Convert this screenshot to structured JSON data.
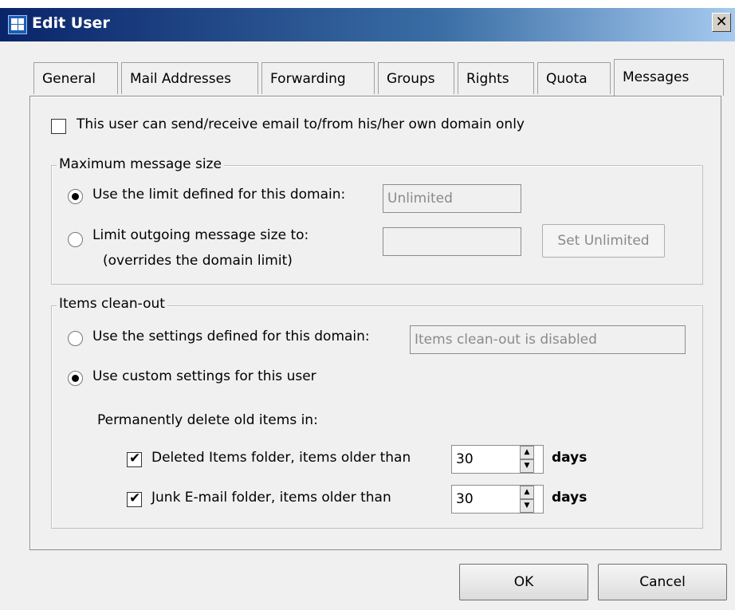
{
  "window": {
    "title": "Edit User",
    "close_glyph": "✕"
  },
  "tabs": [
    {
      "label": "General"
    },
    {
      "label": "Mail Addresses"
    },
    {
      "label": "Forwarding"
    },
    {
      "label": "Groups"
    },
    {
      "label": "Rights"
    },
    {
      "label": "Quota"
    },
    {
      "label": "Messages",
      "active": true
    }
  ],
  "own_domain_only": {
    "label": "This user can send/receive email to/from his/her own domain only",
    "checked": false
  },
  "max_size": {
    "legend": "Maximum message size",
    "use_domain_limit": {
      "label": "Use the limit defined for this domain:",
      "selected": true,
      "value": "Unlimited"
    },
    "limit_outgoing": {
      "label": "Limit outgoing message size to:",
      "note": "(overrides the domain limit)",
      "selected": false,
      "value": ""
    },
    "set_unlimited_label": "Set Unlimited"
  },
  "cleanout": {
    "legend": "Items clean-out",
    "use_domain_settings": {
      "label": "Use the settings defined for this domain:",
      "selected": false,
      "value": "Items clean-out is disabled"
    },
    "use_custom": {
      "label": "Use custom settings for this user",
      "selected": true
    },
    "delete_heading": "Permanently delete old items in:",
    "deleted_items": {
      "label": "Deleted Items folder, items older than",
      "checked": true,
      "value": "30",
      "unit": "days"
    },
    "junk_email": {
      "label": "Junk E-mail folder, items older than",
      "checked": true,
      "value": "30",
      "unit": "days"
    }
  },
  "buttons": {
    "ok": "OK",
    "cancel": "Cancel"
  },
  "icons": {
    "check": "✔",
    "spin_up": "▲",
    "spin_down": "▼"
  }
}
